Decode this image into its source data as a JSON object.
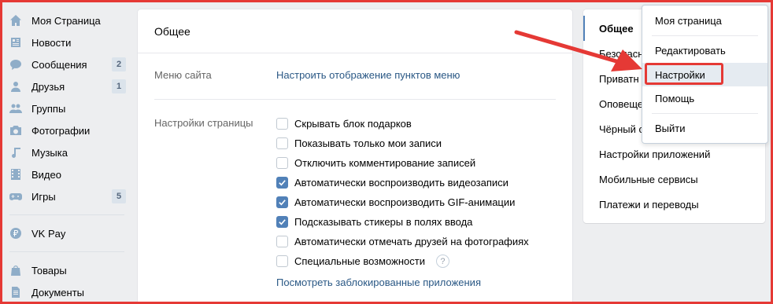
{
  "sidebar": {
    "items": [
      {
        "label": "Моя Страница",
        "icon": "home-icon"
      },
      {
        "label": "Новости",
        "icon": "news-icon"
      },
      {
        "label": "Сообщения",
        "icon": "messages-icon",
        "badge": "2"
      },
      {
        "label": "Друзья",
        "icon": "friend-icon",
        "badge": "1"
      },
      {
        "label": "Группы",
        "icon": "groups-icon"
      },
      {
        "label": "Фотографии",
        "icon": "camera-icon"
      },
      {
        "label": "Музыка",
        "icon": "music-icon"
      },
      {
        "label": "Видео",
        "icon": "video-icon"
      },
      {
        "label": "Игры",
        "icon": "games-icon",
        "badge": "5"
      }
    ],
    "vkpay": {
      "label": "VK Pay",
      "icon": "ruble-icon"
    },
    "bottom": [
      {
        "label": "Товары",
        "icon": "bag-icon"
      },
      {
        "label": "Документы",
        "icon": "document-icon"
      }
    ]
  },
  "main": {
    "title": "Общее",
    "menu_label": "Меню сайта",
    "menu_link": "Настроить отображение пунктов меню",
    "page_settings_label": "Настройки страницы",
    "checkboxes": [
      {
        "label": "Скрывать блок подарков",
        "checked": false
      },
      {
        "label": "Показывать только мои записи",
        "checked": false
      },
      {
        "label": "Отключить комментирование записей",
        "checked": false
      },
      {
        "label": "Автоматически воспроизводить видеозаписи",
        "checked": true
      },
      {
        "label": "Автоматически воспроизводить GIF-анимации",
        "checked": true
      },
      {
        "label": "Подсказывать стикеры в полях ввода",
        "checked": true
      },
      {
        "label": "Автоматически отмечать друзей на фотографиях",
        "checked": false
      },
      {
        "label": "Специальные возможности",
        "checked": false
      }
    ],
    "help_glyph": "?",
    "blocked_apps_link": "Посмотреть заблокированные приложения"
  },
  "settings_menu": {
    "items": [
      {
        "label": "Общее",
        "active": true
      },
      {
        "label": "Безопасн"
      },
      {
        "label": "Приватн"
      },
      {
        "label": "Оповеще"
      },
      {
        "label": "Чёрный с"
      },
      {
        "label": "Настройки приложений"
      },
      {
        "label": "Мобильные сервисы"
      },
      {
        "label": "Платежи и переводы"
      }
    ]
  },
  "dropdown": {
    "items": [
      {
        "label": "Моя страница"
      },
      {
        "label": "Редактировать"
      },
      {
        "label": "Настройки",
        "highlighted": true
      },
      {
        "label": "Помощь"
      },
      {
        "label": "Выйти"
      }
    ]
  },
  "colors": {
    "accent": "#5181b8",
    "link": "#2a5885",
    "annotation_red": "#e53935",
    "background": "#edeef0"
  }
}
